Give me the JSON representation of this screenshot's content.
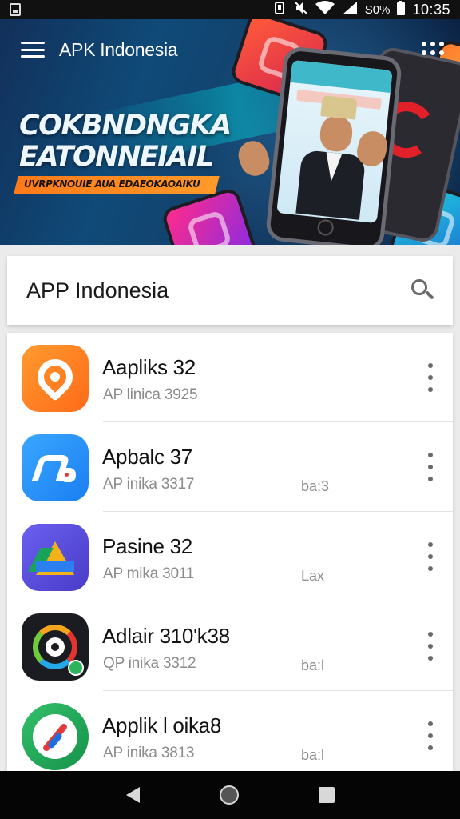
{
  "status_bar": {
    "battery_percent": "S0%",
    "time": "10:35",
    "icons": [
      "notification-icon",
      "vibrate-icon",
      "mute-icon",
      "wifi-icon",
      "cell-signal-icon"
    ]
  },
  "header": {
    "title": "APK Indonesia",
    "menu_icon": "menu-icon",
    "overflow_icon": "overflow-menu-icon"
  },
  "banner": {
    "headline_line1": "COKBNDNGKA",
    "headline_line2": "EATONNEIAIL",
    "ribbon_text": "UVRPKNOUIE AUA EDAEOKAOAIKU",
    "accent_color": "#ff8a22"
  },
  "search": {
    "query": "APP Indonesia",
    "icon": "search-icon"
  },
  "apps": [
    {
      "name": "Aapliks 32",
      "subtitle": "AP linica 3925",
      "extra": "",
      "icon": "orange-chat-icon"
    },
    {
      "name": "Apbalc 37",
      "subtitle": "AP inika 3317",
      "extra": "ba:3",
      "icon": "blue-app-icon"
    },
    {
      "name": "Pasine 32",
      "subtitle": "AP mika 3011",
      "extra": "Lax",
      "icon": "drive-icon"
    },
    {
      "name": "Adlair 310'k38",
      "subtitle": "QP inika 3312",
      "extra": "ba:l",
      "icon": "camera-ring-icon"
    },
    {
      "name": "Applik l oika8",
      "subtitle": "AP inika 3813",
      "extra": "ba:l",
      "icon": "compass-icon"
    }
  ],
  "nav": {
    "back_icon": "back-icon",
    "home_icon": "home-icon",
    "recents_icon": "recents-icon"
  }
}
